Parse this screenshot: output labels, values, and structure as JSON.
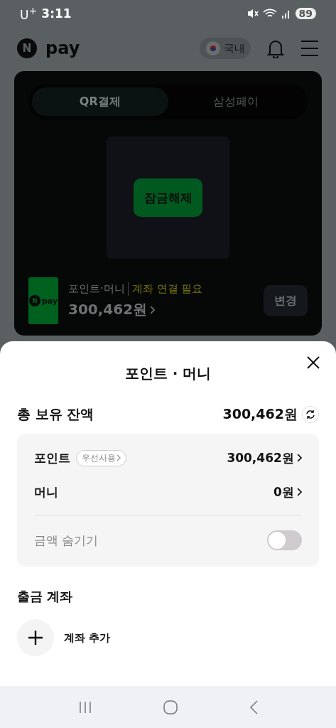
{
  "status_bar": {
    "carrier": "U$^{+}$",
    "time": "3:11",
    "battery": "89"
  },
  "header": {
    "logo_letter": "N",
    "logo_text": "pay",
    "region": "국내"
  },
  "pay_card": {
    "tabs": [
      {
        "label": "QR결제",
        "selected": true
      },
      {
        "label": "삼성페이",
        "selected": false
      }
    ],
    "unlock_button": "잠금해제",
    "payment_method": {
      "logo_letter": "N",
      "logo_text": "pay",
      "name": "포인트·머니",
      "notice": "계좌 연결 필요",
      "amount": "300,462원",
      "change_button": "변경"
    }
  },
  "sheet": {
    "title": "포인트 · 머니",
    "total": {
      "label": "총 보유 잔액",
      "amount": "300,462원"
    },
    "balances": [
      {
        "label": "포인트",
        "badge": "우선사용",
        "amount": "300,462원"
      },
      {
        "label": "머니",
        "amount": "0원"
      }
    ],
    "hide_amount": {
      "label": "금액 숨기기",
      "on": false
    },
    "account_section": {
      "title": "출금 계좌",
      "add_label": "계좌 추가"
    }
  }
}
